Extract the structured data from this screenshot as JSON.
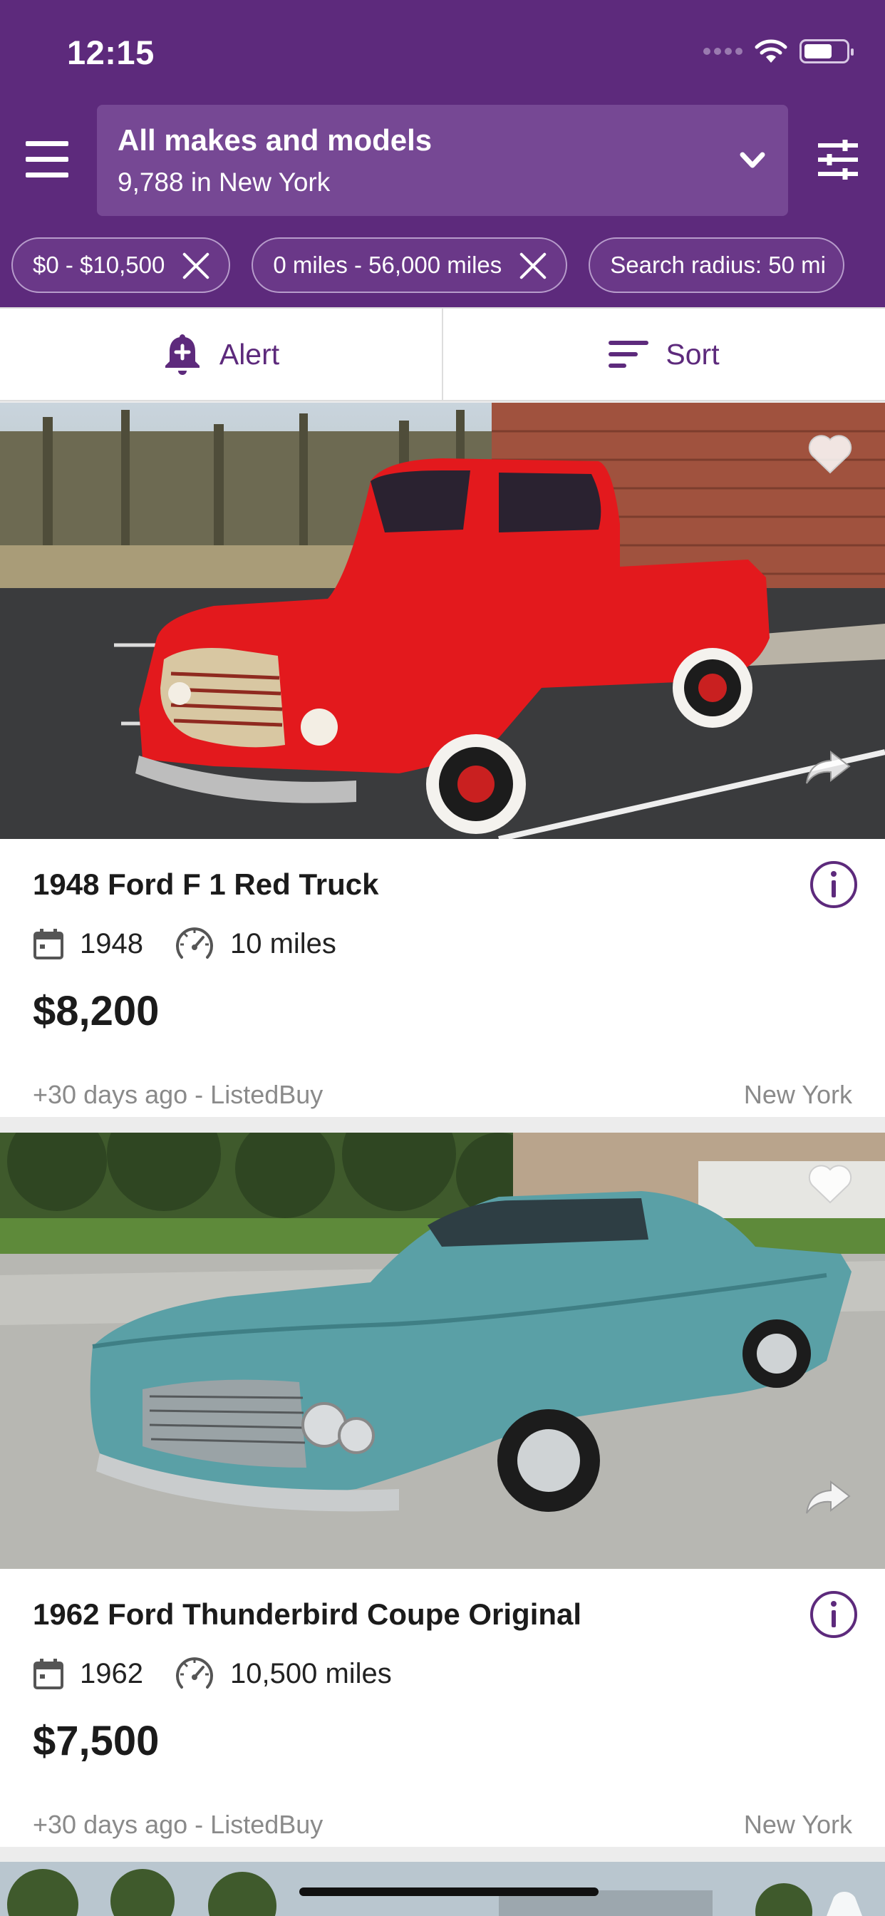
{
  "status_bar": {
    "time": "12:15"
  },
  "search": {
    "title": "All makes and models",
    "subtitle": "9,788 in New York"
  },
  "filter_chips": [
    {
      "label": "$0 - $10,500"
    },
    {
      "label": "0 miles - 56,000 miles"
    },
    {
      "label": "Search radius: 50 mi"
    }
  ],
  "actions": {
    "alert_label": "Alert",
    "sort_label": "Sort"
  },
  "listings": [
    {
      "title": "1948 Ford F 1 Red Truck",
      "year": "1948",
      "mileage": "10 miles",
      "price": "$8,200",
      "posted": "+30 days ago - ListedBuy",
      "location": "New York"
    },
    {
      "title": "1962 Ford Thunderbird Coupe Original",
      "year": "1962",
      "mileage": "10,500 miles",
      "price": "$7,500",
      "posted": "+30 days ago - ListedBuy",
      "location": "New York"
    }
  ],
  "colors": {
    "brand": "#5d2a7c",
    "search_box": "#764894",
    "chip": "#6a3888"
  },
  "icons": [
    "wifi-icon",
    "battery-icon",
    "menu-icon",
    "chevron-down-icon",
    "filter-sliders-icon",
    "bell-plus-icon",
    "sort-icon",
    "heart-icon",
    "share-icon",
    "info-icon",
    "calendar-icon",
    "speedometer-icon"
  ]
}
